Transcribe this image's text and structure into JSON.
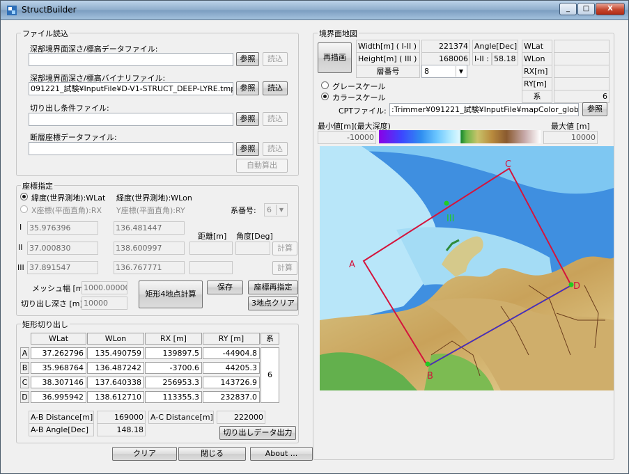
{
  "window": {
    "title": "StructBuilder",
    "min": "_",
    "max": "□",
    "close": "X"
  },
  "file": {
    "legend": "ファイル読込",
    "deep_text_label": "深部境界面深さ/標高データファイル:",
    "deep_bin_label": "深部境界面深さ/標高バイナリファイル:",
    "deep_bin_value": "091221_試験¥InputFile¥D-V1-STRUCT_DEEP-LYRE.tmp",
    "cut_label": "切り出し条件ファイル:",
    "fault_label": "断層座標データファイル:",
    "browse": "参照",
    "load": "読込",
    "auto_calc": "自動算出"
  },
  "coord": {
    "legend": "座標指定",
    "radio_geo": "緯度(世界測地):WLat",
    "geo_lon": "経度(世界測地):WLon",
    "radio_plane": "X座標(平面直角):RX",
    "plane_y": "Y座標(平面直角):RY",
    "system_label": "系番号:",
    "system_value": "6",
    "row1": "I",
    "row2": "II",
    "row3": "III",
    "p1_lat": "35.976396",
    "p1_lon": "136.481447",
    "p2_lat": "37.000830",
    "p2_lon": "138.600997",
    "p3_lat": "37.891547",
    "p3_lon": "136.767771",
    "dist_label": "距離[m]",
    "angle_label": "角度[Deg]",
    "calc": "計算",
    "mesh_label": "メッシュ幅 [m]",
    "mesh_value": "1000.000000",
    "depth_label": "切り出し深さ [m]",
    "depth_value": "10000",
    "rect_calc": "矩形4地点計算",
    "save": "保存",
    "respec": "座標再指定",
    "clear3": "3地点クリア"
  },
  "rect": {
    "legend": "矩形切り出し",
    "headers": [
      "WLat",
      "WLon",
      "RX [m]",
      "RY [m]",
      "系"
    ],
    "rows": [
      {
        "id": "A",
        "lat": "37.262796",
        "lon": "135.490759",
        "rx": "139897.5",
        "ry": "-44904.8"
      },
      {
        "id": "B",
        "lat": "35.968764",
        "lon": "136.487242",
        "rx": "-3700.6",
        "ry": "44205.3"
      },
      {
        "id": "C",
        "lat": "38.307146",
        "lon": "137.640338",
        "rx": "256953.3",
        "ry": "143726.9"
      },
      {
        "id": "D",
        "lat": "36.995942",
        "lon": "138.612710",
        "rx": "113355.3",
        "ry": "232837.0"
      }
    ],
    "system": "6",
    "ab_dist_label": "A-B Distance[m]",
    "ab_dist": "169000",
    "ac_dist_label": "A-C Distance[m]",
    "ac_dist": "222000",
    "ab_angle_label": "A-B Angle[Dec]",
    "ab_angle": "148.18",
    "export": "切り出しデータ出力"
  },
  "bottom": {
    "clear": "クリア",
    "close": "閉じる",
    "about": "About ..."
  },
  "map_panel": {
    "legend": "境界面地図",
    "redraw": "再描画",
    "width_label": "Width[m] ( I-II )",
    "width_value": "221374",
    "height_label": "Height[m] ( III )",
    "height_value": "168006",
    "angle_label": "Angle[Dec]",
    "angle_sub": "I-II :",
    "angle_value": "58.18",
    "layer_label": "層番号",
    "layer_value": "8",
    "wlat": "WLat",
    "wlon": "WLon",
    "rx": "RX[m]",
    "ry": "RY[m]",
    "sys": "系",
    "sys_value": "6",
    "gray": "グレースケール",
    "color": "カラースケール",
    "cpt_label": "CPTファイル:",
    "cpt_value": ":Trimmer¥091221_試験¥InputFile¥mapColor_globe.cpt",
    "browse": "参照",
    "min_label": "最小値[m](最大深度)",
    "max_label": "最大値 [m]",
    "min_value": "-10000",
    "max_value": "10000",
    "point_a": "A",
    "point_b": "B",
    "point_c": "C",
    "point_d": "D",
    "point_3": "III"
  },
  "colors": {
    "rect_line": "#d4143c",
    "point": "#22cc22",
    "sea": "#2a7bd6"
  }
}
